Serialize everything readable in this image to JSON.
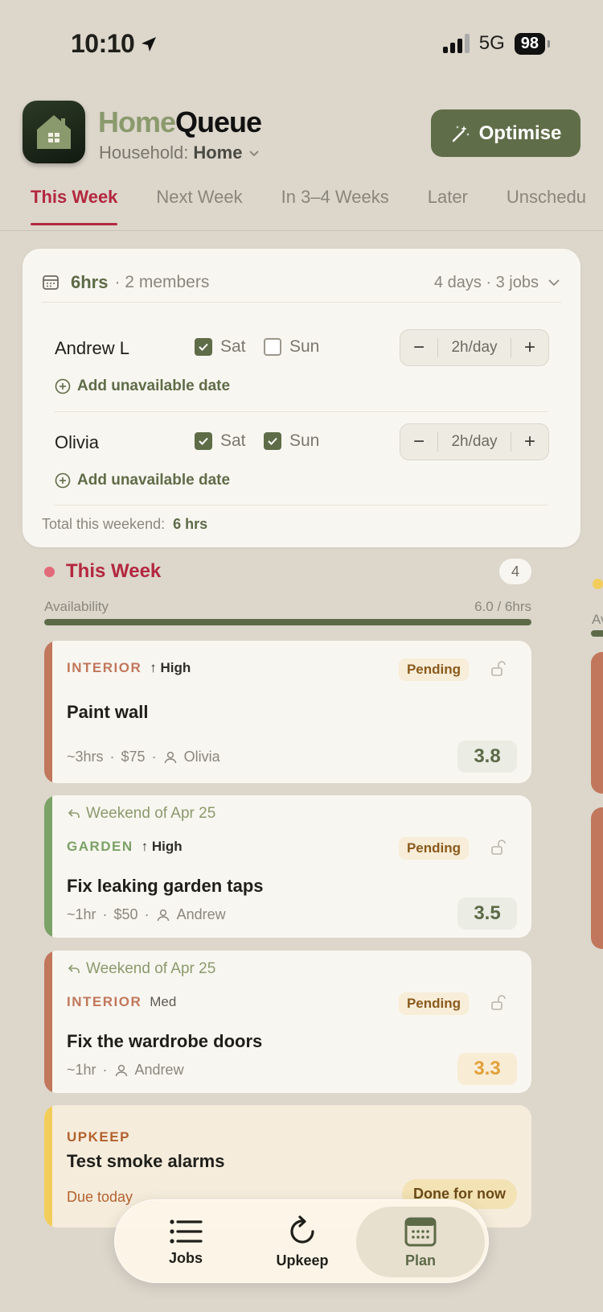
{
  "status_bar": {
    "time": "10:10",
    "network": "5G",
    "battery": "98"
  },
  "header": {
    "title_part1": "Home",
    "title_part2": "Queue",
    "household_label": "Household:",
    "household_value": "Home",
    "optimise_label": "Optimise"
  },
  "tabs": [
    {
      "label": "This Week",
      "active": true
    },
    {
      "label": "Next Week"
    },
    {
      "label": "In 3–4 Weeks"
    },
    {
      "label": "Later"
    },
    {
      "label": "Unschedu"
    }
  ],
  "availability": {
    "hours": "6hrs",
    "members_text": "· 2 members",
    "summary": "4 days · 3 jobs",
    "members": [
      {
        "name": "Andrew L",
        "sat_label": "Sat",
        "sat": true,
        "sun_label": "Sun",
        "sun": false,
        "per_day": "2h/day",
        "add_label": "Add unavailable date"
      },
      {
        "name": "Olivia",
        "sat_label": "Sat",
        "sat": true,
        "sun_label": "Sun",
        "sun": true,
        "per_day": "2h/day",
        "add_label": "Add unavailable date"
      }
    ],
    "total_label": "Total this weekend:",
    "total_value": "6 hrs"
  },
  "week": {
    "title": "This Week",
    "count": "4",
    "availability_label": "Availability",
    "availability_value": "6.0 / 6hrs",
    "availability_fraction": 1.0
  },
  "jobs": [
    {
      "deferred": "",
      "category": "INTERIOR",
      "priority": "↑ High",
      "status": "Pending",
      "title": "Paint wall",
      "duration": "~3hrs",
      "cost": "$75",
      "assignee": "Olivia",
      "score": "3.8"
    },
    {
      "deferred": "Weekend of Apr 25",
      "category": "GARDEN",
      "priority": "↑ High",
      "status": "Pending",
      "title": "Fix leaking garden taps",
      "duration": "~1hr",
      "cost": "$50",
      "assignee": "Andrew",
      "score": "3.5"
    },
    {
      "deferred": "Weekend of Apr 25",
      "category": "INTERIOR",
      "priority": "Med",
      "status": "Pending",
      "title": "Fix the wardrobe doors",
      "duration": "~1hr",
      "cost": "",
      "assignee": "Andrew",
      "score": "3.3"
    }
  ],
  "upkeep": {
    "category": "UPKEEP",
    "title": "Test smoke alarms",
    "due": "Due today",
    "action": "Done for now"
  },
  "side_peek": {
    "label": "Av"
  },
  "bottom_nav": [
    {
      "label": "Jobs",
      "icon": "list-icon"
    },
    {
      "label": "Upkeep",
      "icon": "refresh-icon"
    },
    {
      "label": "Plan",
      "icon": "calendar-icon",
      "active": true
    }
  ],
  "colors": {
    "brand": "#606d49",
    "accent_red": "#b3283f",
    "interior": "#c1775c",
    "garden": "#7ba267",
    "upkeep": "#f3cd5b"
  }
}
